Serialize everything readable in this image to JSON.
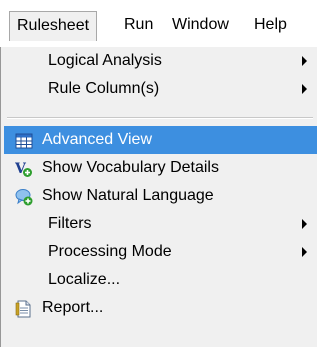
{
  "menubar": {
    "items": [
      {
        "label": "Rulesheet",
        "active": true
      },
      {
        "label": "Run",
        "active": false
      },
      {
        "label": "Window",
        "active": false
      },
      {
        "label": "Help",
        "active": false
      }
    ]
  },
  "dropdown": {
    "items": [
      {
        "label": "Logical Analysis",
        "submenu": true
      },
      {
        "label": "Rule Column(s)",
        "submenu": true
      },
      {
        "label": "Advanced View",
        "icon": "table-grid-icon",
        "highlighted": true
      },
      {
        "label": "Show Vocabulary Details",
        "icon": "vocabulary-add-icon"
      },
      {
        "label": "Show Natural Language",
        "icon": "speech-bubble-add-icon"
      },
      {
        "label": "Filters",
        "submenu": true
      },
      {
        "label": "Processing Mode",
        "submenu": true
      },
      {
        "label": "Localize..."
      },
      {
        "label": "Report...",
        "icon": "report-document-icon"
      }
    ]
  },
  "colors": {
    "highlight": "#3d8fe0",
    "menu_background": "#f0f0f0",
    "icon_green": "#2e9e2e",
    "icon_blue": "#4a8fd6"
  }
}
